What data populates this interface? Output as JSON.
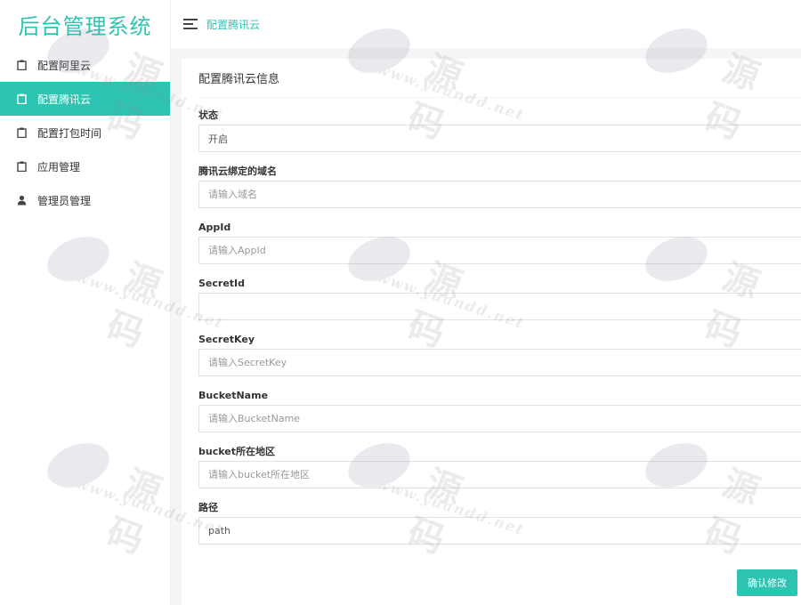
{
  "brand": {
    "title": "后台管理系统"
  },
  "header": {
    "title": "配置腾讯云"
  },
  "sidebar": {
    "items": [
      {
        "label": "配置阿里云",
        "icon": "clipboard-icon",
        "active": false
      },
      {
        "label": "配置腾讯云",
        "icon": "clipboard-icon",
        "active": true
      },
      {
        "label": "配置打包时间",
        "icon": "clipboard-icon",
        "active": false
      },
      {
        "label": "应用管理",
        "icon": "clipboard-icon",
        "active": false
      },
      {
        "label": "管理员管理",
        "icon": "user-icon",
        "active": false
      }
    ]
  },
  "form": {
    "title": "配置腾讯云信息",
    "fields": [
      {
        "label": "状态",
        "value": "开启",
        "placeholder": ""
      },
      {
        "label": "腾讯云绑定的域名",
        "value": "",
        "placeholder": "请输入域名"
      },
      {
        "label": "AppId",
        "value": "",
        "placeholder": "请输入AppId"
      },
      {
        "label": "SecretId",
        "value": "",
        "placeholder": ""
      },
      {
        "label": "SecretKey",
        "value": "",
        "placeholder": "请输入SecretKey"
      },
      {
        "label": "BucketName",
        "value": "",
        "placeholder": "请输入BucketName"
      },
      {
        "label": "bucket所在地区",
        "value": "",
        "placeholder": "请输入bucket所在地区"
      },
      {
        "label": "路径",
        "value": "path",
        "placeholder": ""
      }
    ],
    "submit_label": "确认修改"
  },
  "watermark": {
    "text": "源码",
    "url": "www.yuandd.net"
  },
  "colors": {
    "accent": "#2fc4b2"
  }
}
